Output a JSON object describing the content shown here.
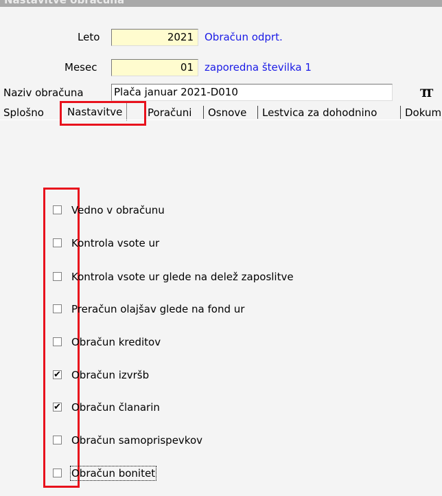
{
  "window": {
    "title": "Nastavitve obračuna"
  },
  "header": {
    "leto": {
      "label": "Leto",
      "value": "2021",
      "note": "Obračun odprt."
    },
    "mesec": {
      "label": "Mesec",
      "value": "01",
      "note": "zaporedna številka 1"
    },
    "naziv": {
      "label": "Naziv obračuna",
      "value": "Plača januar 2021-D010"
    },
    "font_icon": "TT"
  },
  "tabs": [
    {
      "label": "Splošno"
    },
    {
      "label": "Nastavitve"
    },
    {
      "label": "Poračuni"
    },
    {
      "label": "Osnove"
    },
    {
      "label": "Lestvica za dohodnino"
    },
    {
      "label": "Dokum"
    }
  ],
  "options": [
    {
      "label": "Vedno v obračunu",
      "checked": false
    },
    {
      "label": "Kontrola vsote ur",
      "checked": false
    },
    {
      "label": "Kontrola vsote ur glede na delež zaposlitve",
      "checked": false
    },
    {
      "label": "Preračun olajšav glede na fond ur",
      "checked": false
    },
    {
      "label": "Obračun kreditov",
      "checked": false
    },
    {
      "label": "Obračun izvršb",
      "checked": true
    },
    {
      "label": "Obračun članarin",
      "checked": true
    },
    {
      "label": "Obračun samoprispevkov",
      "checked": false
    },
    {
      "label": "Obračun bonitet",
      "checked": false
    }
  ],
  "colors": {
    "highlight": "#e8111c",
    "note_text": "#1a1ae6",
    "field_bg": "#fffccf"
  }
}
